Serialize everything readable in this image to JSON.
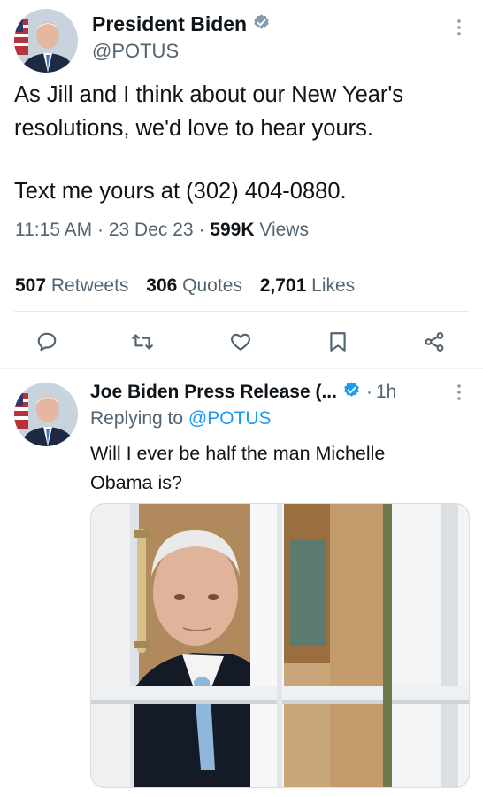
{
  "main_tweet": {
    "author_name": "President Biden",
    "handle": "@POTUS",
    "text_line1": "As Jill and I think about our New Year's resolutions, we'd love to hear yours.",
    "text_line2": "Text me yours at (302) 404-0880.",
    "time": "11:15 AM",
    "date": "23 Dec 23",
    "views_count": "599K",
    "views_label": "Views",
    "retweets_count": "507",
    "retweets_label": "Retweets",
    "quotes_count": "306",
    "quotes_label": "Quotes",
    "likes_count": "2,701",
    "likes_label": "Likes"
  },
  "reply_tweet": {
    "author_name": "Joe Biden Press Release (...",
    "time_ago": "1h",
    "replying_prefix": "Replying to",
    "replying_handle": "@POTUS",
    "text": "Will I ever be half the man Michelle Obama is?"
  },
  "separators": {
    "dot": "·"
  },
  "icons": {
    "verified": "verified-badge-icon",
    "more": "more-vertical-icon",
    "reply": "reply-icon",
    "retweet": "retweet-icon",
    "like": "heart-icon",
    "bookmark": "bookmark-icon",
    "share": "share-icon"
  },
  "colors": {
    "accent": "#1d9bf0",
    "text": "#0f1419",
    "secondary": "#536471"
  }
}
